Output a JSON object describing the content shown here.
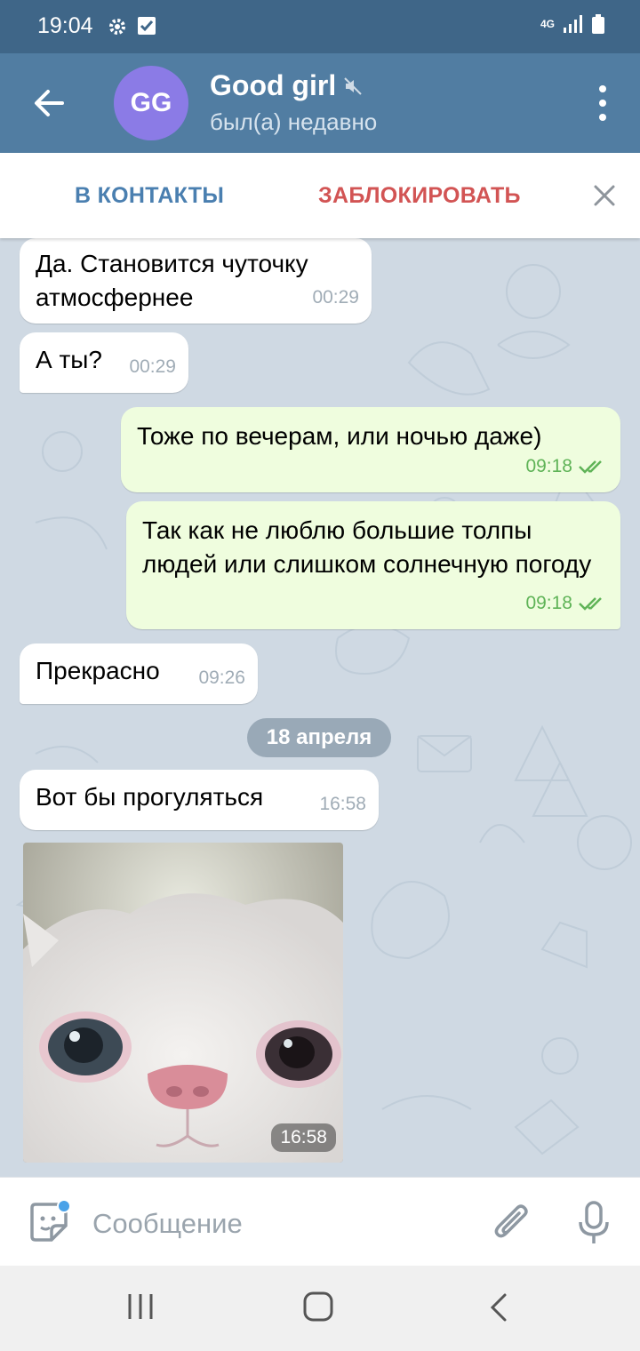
{
  "status_bar": {
    "time": "19:04",
    "network": "4G"
  },
  "header": {
    "avatar_initials": "GG",
    "contact_name": "Good girl",
    "status": "был(а) недавно",
    "avatar_color": "#8b7be6"
  },
  "action_bar": {
    "add_contact": "В КОНТАКТЫ",
    "block": "ЗАБЛОКИРОВАТЬ"
  },
  "messages": [
    {
      "direction": "in",
      "text": "Да. Становится чуточку атмосфернее",
      "time": "00:29"
    },
    {
      "direction": "in",
      "text": "А ты?",
      "time": "00:29"
    },
    {
      "direction": "out",
      "text": "Тоже по вечерам, или ночью даже)",
      "time": "09:18",
      "read": true
    },
    {
      "direction": "out",
      "text": "Так как не люблю большие толпы людей или слишком солнечную погоду",
      "time": "09:18",
      "read": true
    },
    {
      "direction": "in",
      "text": "Прекрасно",
      "time": "09:26"
    },
    {
      "direction": "in",
      "text": "Вот бы прогуляться",
      "time": "16:58"
    },
    {
      "direction": "in",
      "type": "photo",
      "time": "16:58"
    }
  ],
  "date_separator": "18 апреля",
  "composer": {
    "placeholder": "Сообщение"
  },
  "colors": {
    "header_bg": "#517da2",
    "status_bg": "#3f6688",
    "incoming_bubble": "#ffffff",
    "outgoing_bubble": "#effdde",
    "read_check": "#5fb357",
    "block_red": "#d25454",
    "link_blue": "#4a7fb0"
  }
}
